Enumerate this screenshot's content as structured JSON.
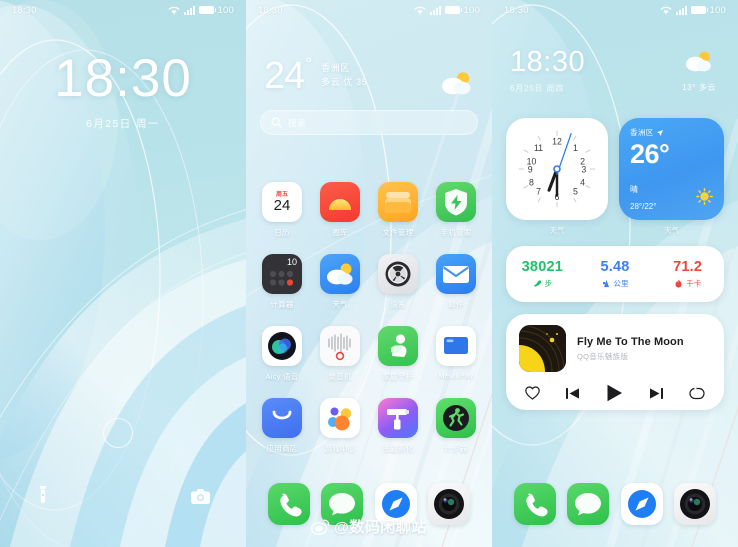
{
  "status_bar": {
    "time": "18:30",
    "battery": "100",
    "icons": [
      "wifi-icon",
      "signal-icon",
      "battery-icon"
    ]
  },
  "lock_screen": {
    "time": "18:30",
    "date": "6月25日 周一",
    "flashlight_icon": "flashlight-icon",
    "camera_icon": "camera-icon"
  },
  "home_screen": {
    "weather": {
      "temp": "24",
      "degree": "°",
      "district": "香洲区",
      "condition": "多云 优 35",
      "icon": "partly-cloudy-icon"
    },
    "search": {
      "placeholder": "搜索",
      "icon": "search-icon"
    },
    "apps": [
      [
        {
          "label": "日历",
          "icon": "calendar-icon",
          "weekday": "周五",
          "day": "24"
        },
        {
          "label": "图库",
          "icon": "gallery-icon"
        },
        {
          "label": "文件管理",
          "icon": "files-icon"
        },
        {
          "label": "手机管家",
          "icon": "security-icon"
        }
      ],
      [
        {
          "label": "计算器",
          "icon": "calculator-icon",
          "display": "10"
        },
        {
          "label": "天气",
          "icon": "weather-icon"
        },
        {
          "label": "设置",
          "icon": "settings-icon"
        },
        {
          "label": "邮件",
          "icon": "mail-icon"
        }
      ],
      [
        {
          "label": "Aicy 语音",
          "icon": "voice-assistant-icon"
        },
        {
          "label": "录音机",
          "icon": "recorder-icon"
        },
        {
          "label": "家庭守护",
          "icon": "family-guard-icon"
        },
        {
          "label": "MeizuPay",
          "icon": "wallet-icon"
        }
      ],
      [
        {
          "label": "应用商店",
          "icon": "app-store-icon"
        },
        {
          "label": "游戏中心",
          "icon": "game-center-icon"
        },
        {
          "label": "主题美化",
          "icon": "themes-icon"
        },
        {
          "label": "计步器",
          "icon": "pedometer-icon"
        }
      ]
    ],
    "dock": [
      {
        "label": "phone",
        "icon": "phone-icon"
      },
      {
        "label": "messages",
        "icon": "messages-icon"
      },
      {
        "label": "browser",
        "icon": "compass-icon"
      },
      {
        "label": "camera",
        "icon": "camera-lens-icon"
      }
    ]
  },
  "widget_screen": {
    "clock": {
      "time": "18:30",
      "date": "6月25日 周四"
    },
    "weather_top": {
      "temp": "13°",
      "condition": "多云",
      "icon": "partly-cloudy-icon"
    },
    "clock_widget": {
      "label": "天气",
      "hour": 6,
      "minute": 30,
      "numerals": [
        "12",
        "1",
        "2",
        "3",
        "4",
        "5",
        "6",
        "7",
        "8",
        "9",
        "10",
        "11"
      ]
    },
    "weather_widget": {
      "label": "天气",
      "district": "香洲区",
      "temp": "26°",
      "condition": "晴",
      "high_low": "28°/22°",
      "icon": "sun-icon"
    },
    "fitness": [
      {
        "value": "38021",
        "unit": "步",
        "icon": "shoe-icon",
        "color": "#22c06a"
      },
      {
        "value": "5.48",
        "unit": "公里",
        "icon": "route-icon",
        "color": "#3f7ff0"
      },
      {
        "value": "71.2",
        "unit": "千卡",
        "icon": "flame-icon",
        "color": "#f0453a"
      }
    ],
    "music": {
      "title": "Fly Me To The Moon",
      "artist": "QQ音乐魅族版",
      "controls": [
        "heart-icon",
        "previous-icon",
        "play-icon",
        "next-icon",
        "repeat-icon"
      ]
    }
  },
  "watermark": {
    "text": "@数码闲聊站",
    "icon": "weibo-icon"
  }
}
